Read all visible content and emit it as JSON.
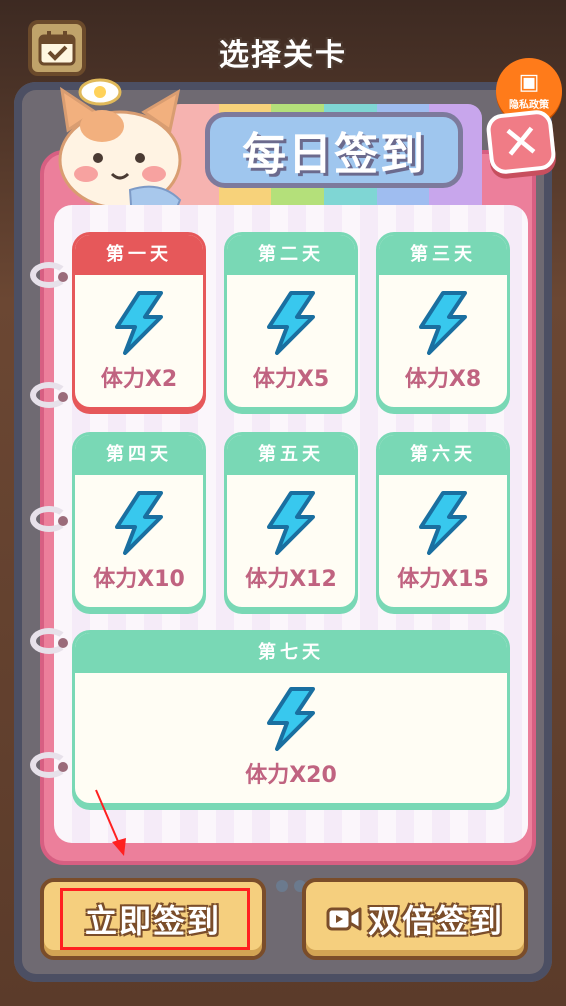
{
  "screen": {
    "title": "选择关卡"
  },
  "privacy": {
    "label": "隐私政策"
  },
  "dialog": {
    "title": "每日签到"
  },
  "days": [
    {
      "header": "第一天",
      "reward": "体力X2"
    },
    {
      "header": "第二天",
      "reward": "体力X5"
    },
    {
      "header": "第三天",
      "reward": "体力X8"
    },
    {
      "header": "第四天",
      "reward": "体力X10"
    },
    {
      "header": "第五天",
      "reward": "体力X12"
    },
    {
      "header": "第六天",
      "reward": "体力X15"
    },
    {
      "header": "第七天",
      "reward": "体力X20"
    }
  ],
  "buttons": {
    "sign_now": "立即签到",
    "double_sign": "双倍签到"
  },
  "colors": {
    "panel": "#ec7f9b",
    "card_header_green": "#79d8b5",
    "card_header_red": "#e6585a",
    "reward_text": "#c06380",
    "button": "#f5cf7e",
    "highlight": "#ff2020"
  },
  "icons": {
    "calendar": "calendar-icon",
    "privacy": "shield-doc-icon",
    "close": "close-icon",
    "energy": "lightning-bolt-icon",
    "video": "video-icon"
  }
}
